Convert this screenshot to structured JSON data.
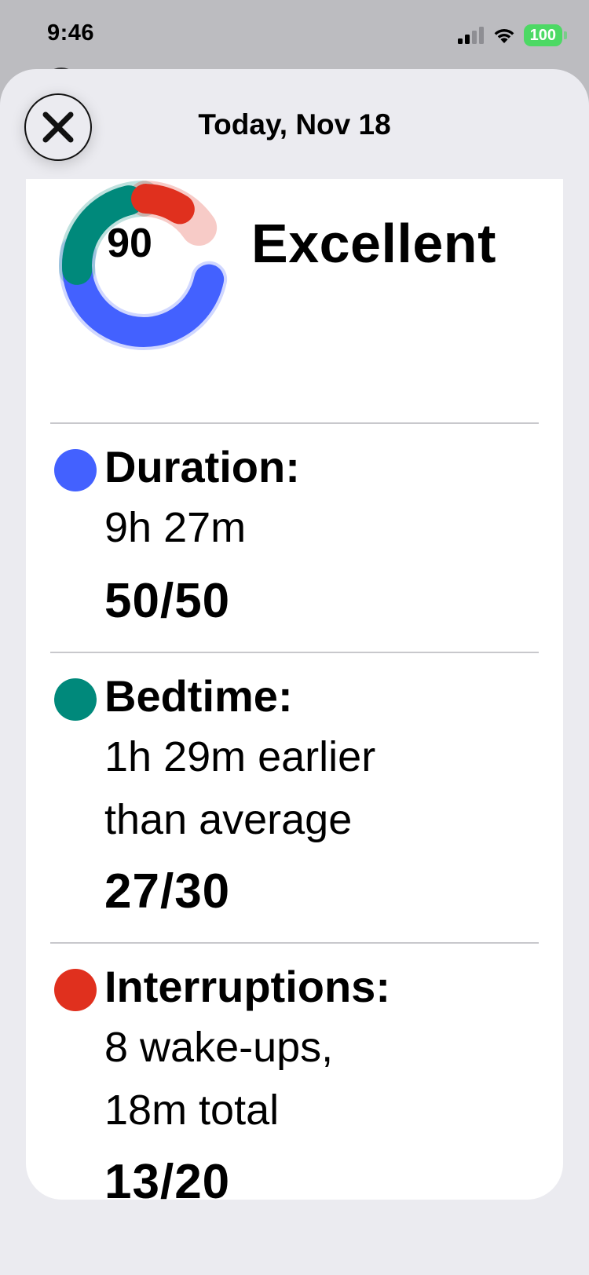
{
  "status_bar": {
    "time": "9:46",
    "battery": "100"
  },
  "header": {
    "title": "Today, Nov 18"
  },
  "score": {
    "value": "90",
    "label": "Excellent",
    "ring_segments": [
      {
        "name": "duration",
        "fraction": 0.5,
        "color": "#4361ff"
      },
      {
        "name": "bedtime",
        "fraction": 0.27,
        "color": "#00897b"
      },
      {
        "name": "interruptions",
        "fraction": 0.13,
        "color": "#e0301e"
      }
    ]
  },
  "sections": [
    {
      "title": "Duration:",
      "detail_lines": [
        "9h 27m"
      ],
      "score": "50/50",
      "color": "#4361ff"
    },
    {
      "title": "Bedtime:",
      "detail_lines": [
        "1h 29m earlier",
        "than average"
      ],
      "score": "27/30",
      "color": "#00897b"
    },
    {
      "title": "Interruptions:",
      "detail_lines": [
        "8 wake-ups,",
        "18m total"
      ],
      "score": "13/20",
      "color": "#e0301e"
    }
  ]
}
